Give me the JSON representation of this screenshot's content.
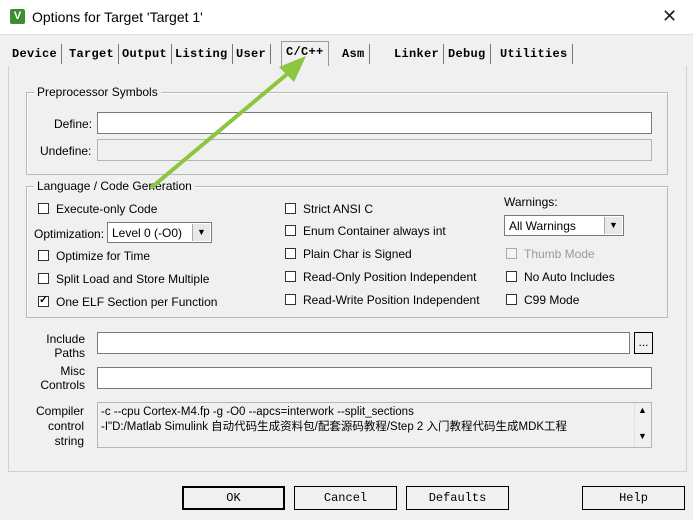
{
  "window": {
    "title": "Options for Target 'Target 1'",
    "icon_letter": "V",
    "close_glyph": "✕"
  },
  "tabs": [
    "Device",
    "Target",
    "Output",
    "Listing",
    "User",
    "C/C++",
    "Asm",
    "Linker",
    "Debug",
    "Utilities"
  ],
  "active_tab": "C/C++",
  "preprocessor": {
    "legend": "Preprocessor Symbols",
    "define_label": "Define:",
    "define_value": "",
    "undefine_label": "Undefine:",
    "undefine_value": ""
  },
  "language": {
    "legend": "Language / Code Generation",
    "execute_only": {
      "label": "Execute-only Code",
      "checked": false
    },
    "optimization_label": "Optimization:",
    "optimization_value": "Level 0 (-O0)",
    "optimize_time": {
      "label": "Optimize for Time",
      "checked": false
    },
    "split_load": {
      "label": "Split Load and Store Multiple",
      "checked": false
    },
    "one_elf": {
      "label": "One ELF Section per Function",
      "checked": true
    },
    "strict_ansi": {
      "label": "Strict ANSI C",
      "checked": false
    },
    "enum_container": {
      "label": "Enum Container always int",
      "checked": false
    },
    "plain_char": {
      "label": "Plain Char is Signed",
      "checked": false
    },
    "ro_pi": {
      "label": "Read-Only Position Independent",
      "checked": false
    },
    "rw_pi": {
      "label": "Read-Write Position Independent",
      "checked": false
    },
    "warnings_label": "Warnings:",
    "warnings_value": "All Warnings",
    "thumb_mode": {
      "label": "Thumb Mode",
      "checked": false,
      "disabled": true
    },
    "no_auto_includes": {
      "label": "No Auto Includes",
      "checked": false
    },
    "c99_mode": {
      "label": "C99 Mode",
      "checked": false
    }
  },
  "include_paths": {
    "label_line1": "Include",
    "label_line2": "Paths",
    "value": "",
    "browse_label": "..."
  },
  "misc_controls": {
    "label_line1": "Misc",
    "label_line2": "Controls",
    "value": ""
  },
  "compiler_control": {
    "label_line1": "Compiler",
    "label_line2": "control",
    "label_line3": "string",
    "line1": "-c --cpu Cortex-M4.fp -g -O0 --apcs=interwork --split_sections",
    "line2": "-I\"D:/Matlab Simulink 自动代码生成资料包/配套源码教程/Step 2 入门教程代码生成MDK工程"
  },
  "buttons": {
    "ok": "OK",
    "cancel": "Cancel",
    "defaults": "Defaults",
    "help": "Help"
  },
  "annotation": {
    "arrow_color": "#8cc63f"
  }
}
